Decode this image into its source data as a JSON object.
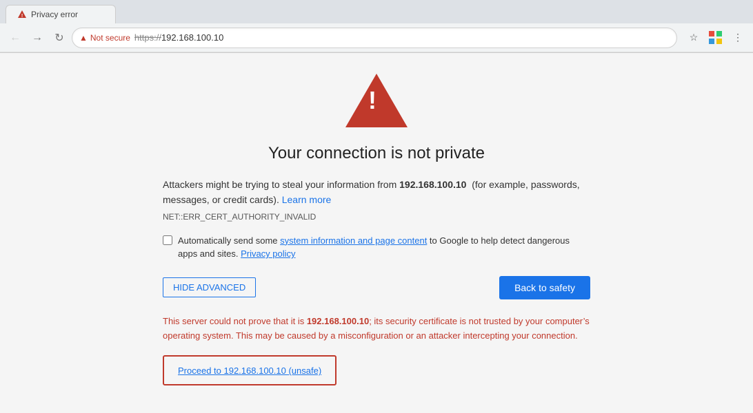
{
  "browser": {
    "tab": {
      "title": "Privacy error"
    },
    "address": {
      "not_secure_label": "Not secure",
      "url_strikethrough": "https://",
      "url_plain": "192.168.100.10"
    },
    "nav": {
      "back_title": "Back",
      "forward_title": "Forward",
      "reload_title": "Reload",
      "star_title": "Bookmark this tab",
      "more_title": "Customize and control Google Chrome"
    }
  },
  "page": {
    "heading": "Your connection is not private",
    "description_part1": "Attackers might be trying to steal your information from ",
    "description_bold": "192.168.100.10",
    "description_part2": "  (for example, passwords, messages, or credit cards). ",
    "learn_more": "Learn more",
    "error_code": "NET::ERR_CERT_AUTHORITY_INVALID",
    "checkbox_label_part1": "Automatically send some ",
    "checkbox_link": "system information and page content",
    "checkbox_label_part2": " to Google to help detect dangerous apps and sites. ",
    "privacy_policy": "Privacy policy",
    "btn_hide_advanced": "HIDE ADVANCED",
    "btn_back_to_safety": "Back to safety",
    "advanced_text_part1": "This server could not prove that it is ",
    "advanced_text_bold": "192.168.100.10",
    "advanced_text_part2": "; its security certificate is not trusted by your computer’s operating system. This may be caused by a misconfiguration or an attacker intercepting your connection.",
    "proceed_link": "Proceed to 192.168.100.10 (unsafe)"
  }
}
